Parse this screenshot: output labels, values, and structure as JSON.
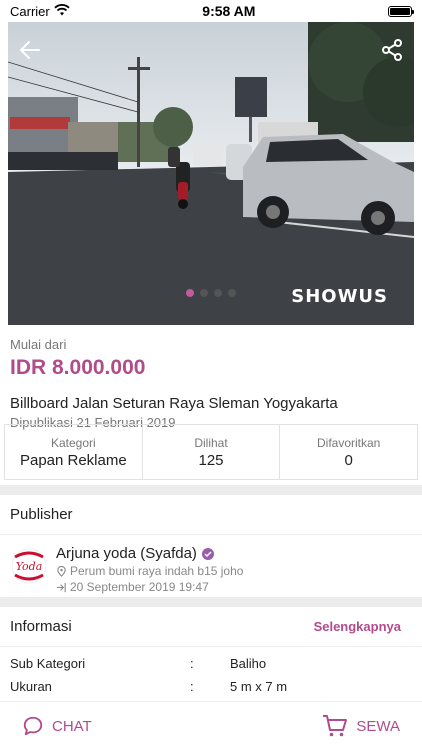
{
  "status_bar": {
    "carrier": "Carrier",
    "time": "9:58 AM"
  },
  "hero": {
    "watermark": "SHOWUS",
    "dots": [
      true,
      false,
      false,
      false
    ],
    "accent": "#c35a9a"
  },
  "listing": {
    "price_label": "Mulai dari",
    "price": "IDR 8.000.000",
    "title": "Billboard Jalan Seturan Raya Sleman Yogyakarta",
    "published": "Dipublikasi 21 Februari 2019"
  },
  "stats": [
    {
      "label": "Kategori",
      "value": "Papan Reklame"
    },
    {
      "label": "Dilihat",
      "value": "125"
    },
    {
      "label": "Difavoritkan",
      "value": "0"
    }
  ],
  "publisher": {
    "heading": "Publisher",
    "logo_text": "Yoda",
    "name": "Arjuna yoda (Syafda)",
    "address": "Perum bumi raya indah b15 joho",
    "joined": "20 September 2019 19:47"
  },
  "info": {
    "heading": "Informasi",
    "more": "Selengkapnya",
    "rows": [
      {
        "key": "Sub Kategori",
        "sep": ":",
        "value": "Baliho"
      },
      {
        "key": "Ukuran",
        "sep": ":",
        "value": "5 m x 7 m"
      }
    ]
  },
  "actions": {
    "chat": "CHAT",
    "rent": "SEWA"
  },
  "colors": {
    "brand": "#b04c8c",
    "verified": "#9a5dac"
  },
  "icons": [
    "wifi-icon",
    "battery-icon",
    "back-arrow-icon",
    "share-icon",
    "location-pin-icon",
    "login-arrow-icon",
    "verified-badge-icon",
    "chat-bubble-icon",
    "cart-icon"
  ]
}
